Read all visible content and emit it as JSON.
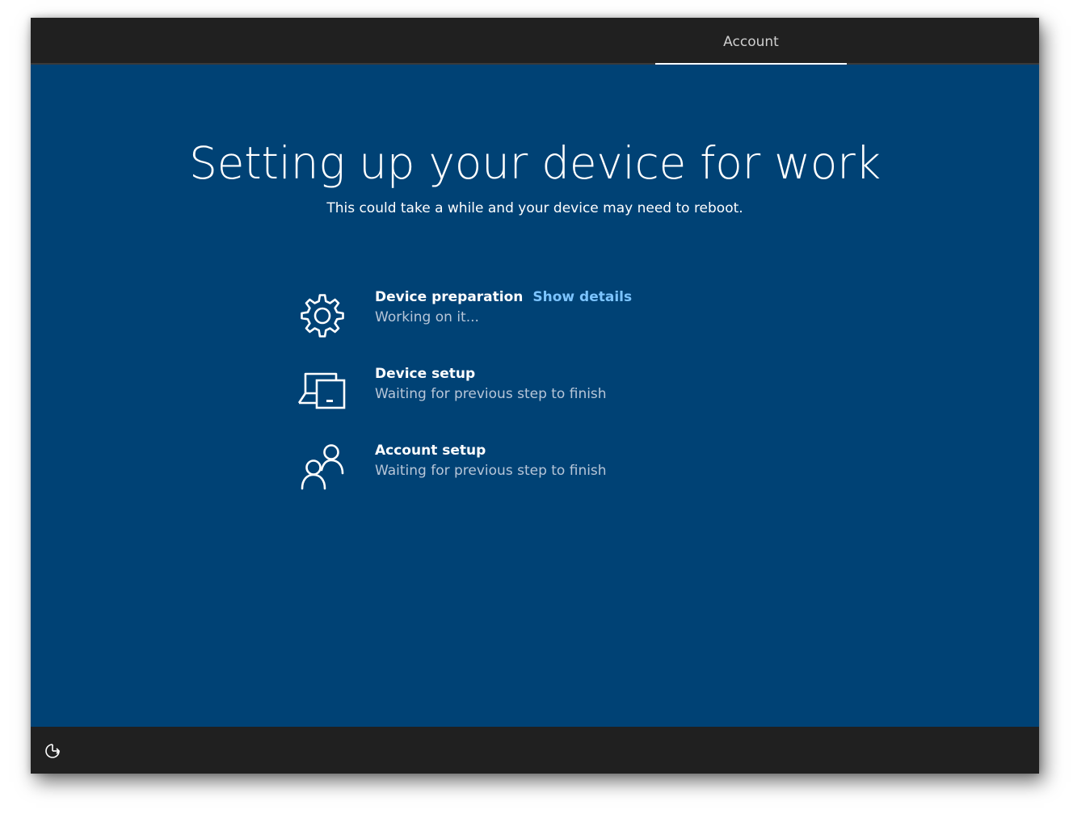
{
  "header": {
    "tabs": [
      {
        "label": "Account",
        "active": true
      }
    ]
  },
  "main": {
    "title": "Setting up your device for work",
    "subtitle": "This could take a while and your device may need to reboot.",
    "steps": [
      {
        "title": "Device preparation",
        "status": "Working on it...",
        "link": "Show details",
        "icon": "gear-icon"
      },
      {
        "title": "Device setup",
        "status": "Waiting for previous step to finish",
        "icon": "devices-icon"
      },
      {
        "title": "Account setup",
        "status": "Waiting for previous step to finish",
        "icon": "people-icon"
      }
    ]
  },
  "footer": {
    "icon": "ease-of-access-icon"
  },
  "colors": {
    "background": "#004275",
    "bars": "#202020",
    "link": "#7cc4ff",
    "status_text": "#b7c6d8"
  }
}
